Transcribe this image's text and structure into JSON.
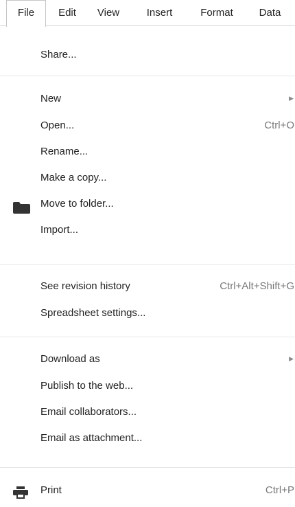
{
  "menubar": {
    "items": [
      {
        "label": "File"
      },
      {
        "label": "Edit"
      },
      {
        "label": "View"
      },
      {
        "label": "Insert"
      },
      {
        "label": "Format"
      },
      {
        "label": "Data"
      }
    ]
  },
  "menu": {
    "share": "Share...",
    "new": "New",
    "open": "Open...",
    "open_shortcut": "Ctrl+O",
    "rename": "Rename...",
    "make_copy": "Make a copy...",
    "move_to_folder": "Move to folder...",
    "import": "Import...",
    "revision_history": "See revision history",
    "revision_history_shortcut": "Ctrl+Alt+Shift+G",
    "spreadsheet_settings": "Spreadsheet settings...",
    "download_as": "Download as",
    "publish": "Publish to the web...",
    "email_collaborators": "Email collaborators...",
    "email_attachment": "Email as attachment...",
    "print": "Print",
    "print_shortcut": "Ctrl+P",
    "submenu_arrow": "▶",
    "icons": {
      "move_to_folder": "folder-icon",
      "print": "printer-icon"
    }
  }
}
